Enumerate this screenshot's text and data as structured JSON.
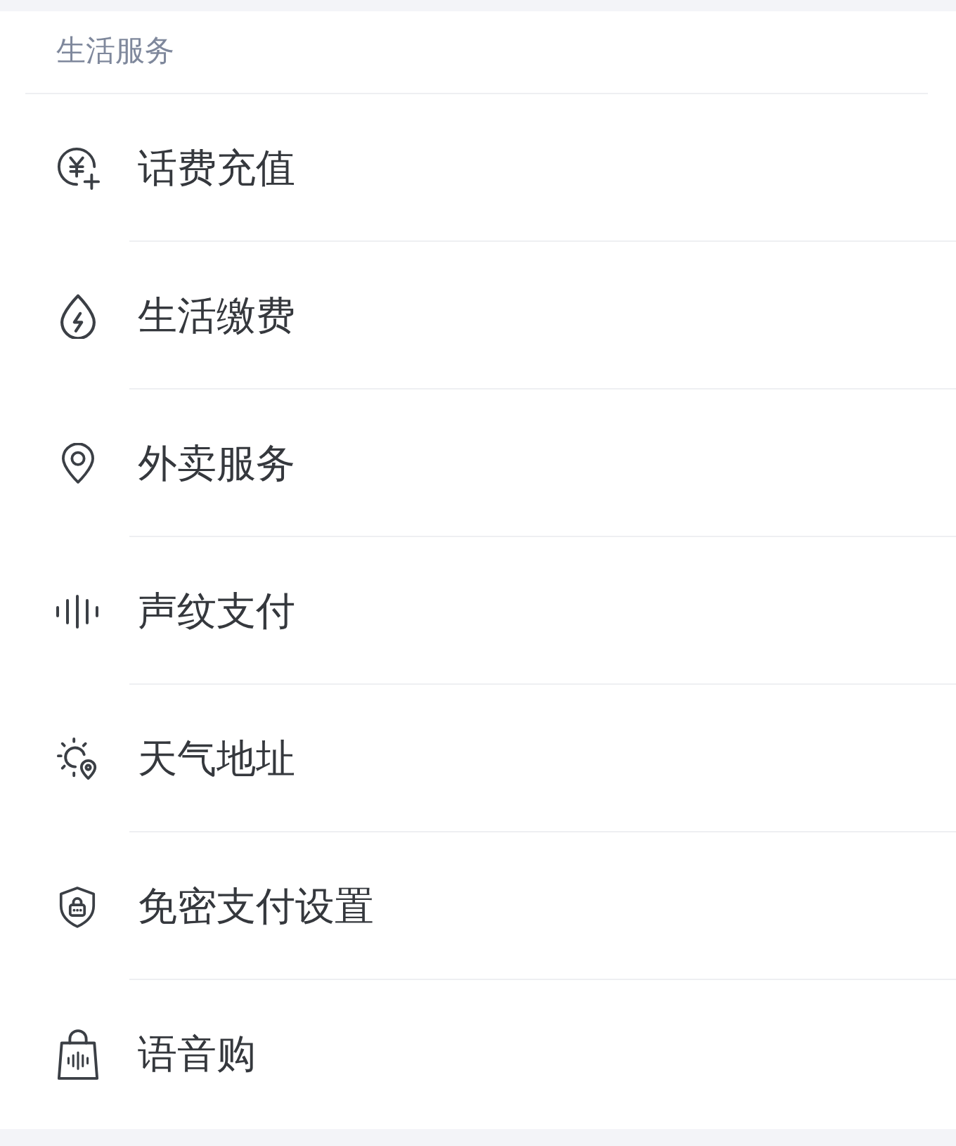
{
  "section": {
    "title": "生活服务"
  },
  "items": [
    {
      "label": "话费充值"
    },
    {
      "label": "生活缴费"
    },
    {
      "label": "外卖服务"
    },
    {
      "label": "声纹支付"
    },
    {
      "label": "天气地址"
    },
    {
      "label": "免密支付设置"
    },
    {
      "label": "语音购"
    }
  ]
}
